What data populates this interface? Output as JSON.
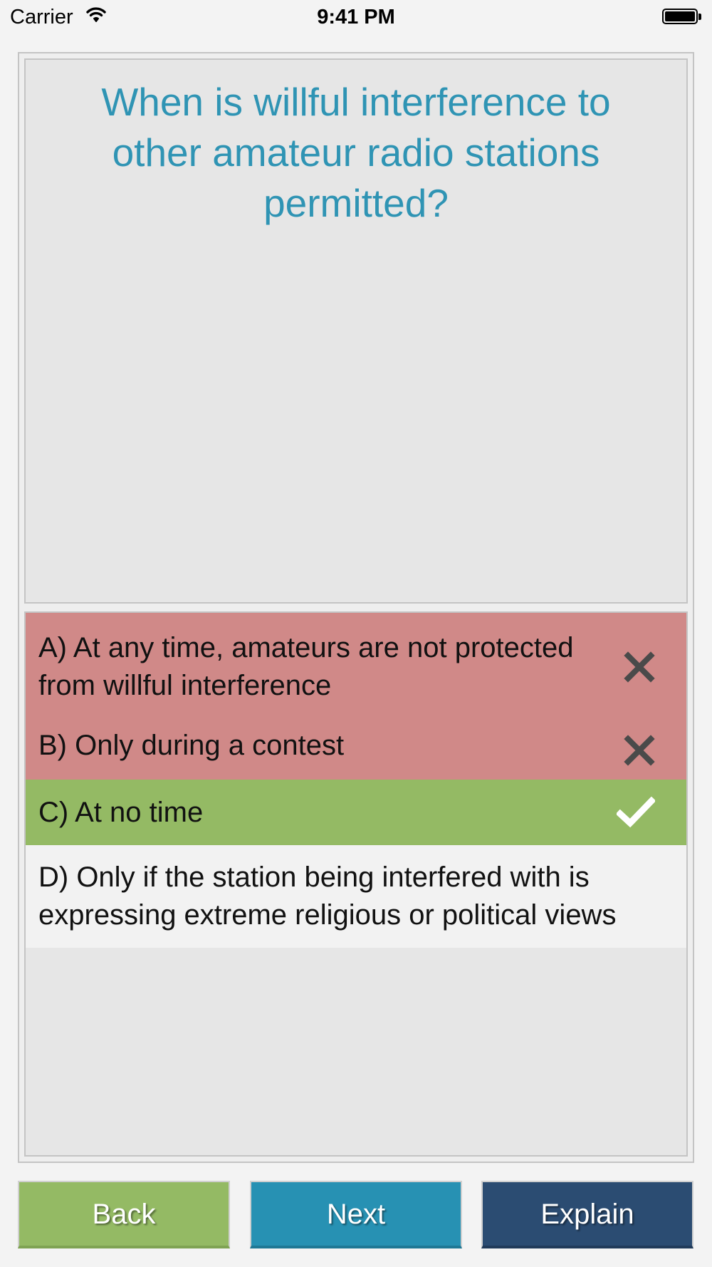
{
  "status_bar": {
    "carrier": "Carrier",
    "time": "9:41 PM",
    "wifi_icon": "wifi-icon",
    "battery_icon": "battery-icon",
    "battery_level": 1.0
  },
  "question": {
    "text": "When is willful interference to other amateur radio stations permitted?",
    "color": "#2f94b4"
  },
  "answers": [
    {
      "label": "A) At any time, amateurs are not protected from willful interference",
      "status": "wrong",
      "icon": "x-mark-icon",
      "color": "#d08988"
    },
    {
      "label": "B) Only during a contest",
      "status": "wrong",
      "icon": "x-mark-icon",
      "color": "#d08988"
    },
    {
      "label": "C) At no time",
      "status": "correct",
      "icon": "checkmark-icon",
      "color": "#94ba64"
    },
    {
      "label": "D) Only if the station being interfered with is expressing extreme religious or political views",
      "status": "unselected",
      "icon": "",
      "color": "#f2f2f2"
    }
  ],
  "buttons": {
    "back": {
      "label": "Back",
      "color": "#94ba64"
    },
    "next": {
      "label": "Next",
      "color": "#2791b3"
    },
    "explain": {
      "label": "Explain",
      "color": "#2b4c72"
    }
  }
}
